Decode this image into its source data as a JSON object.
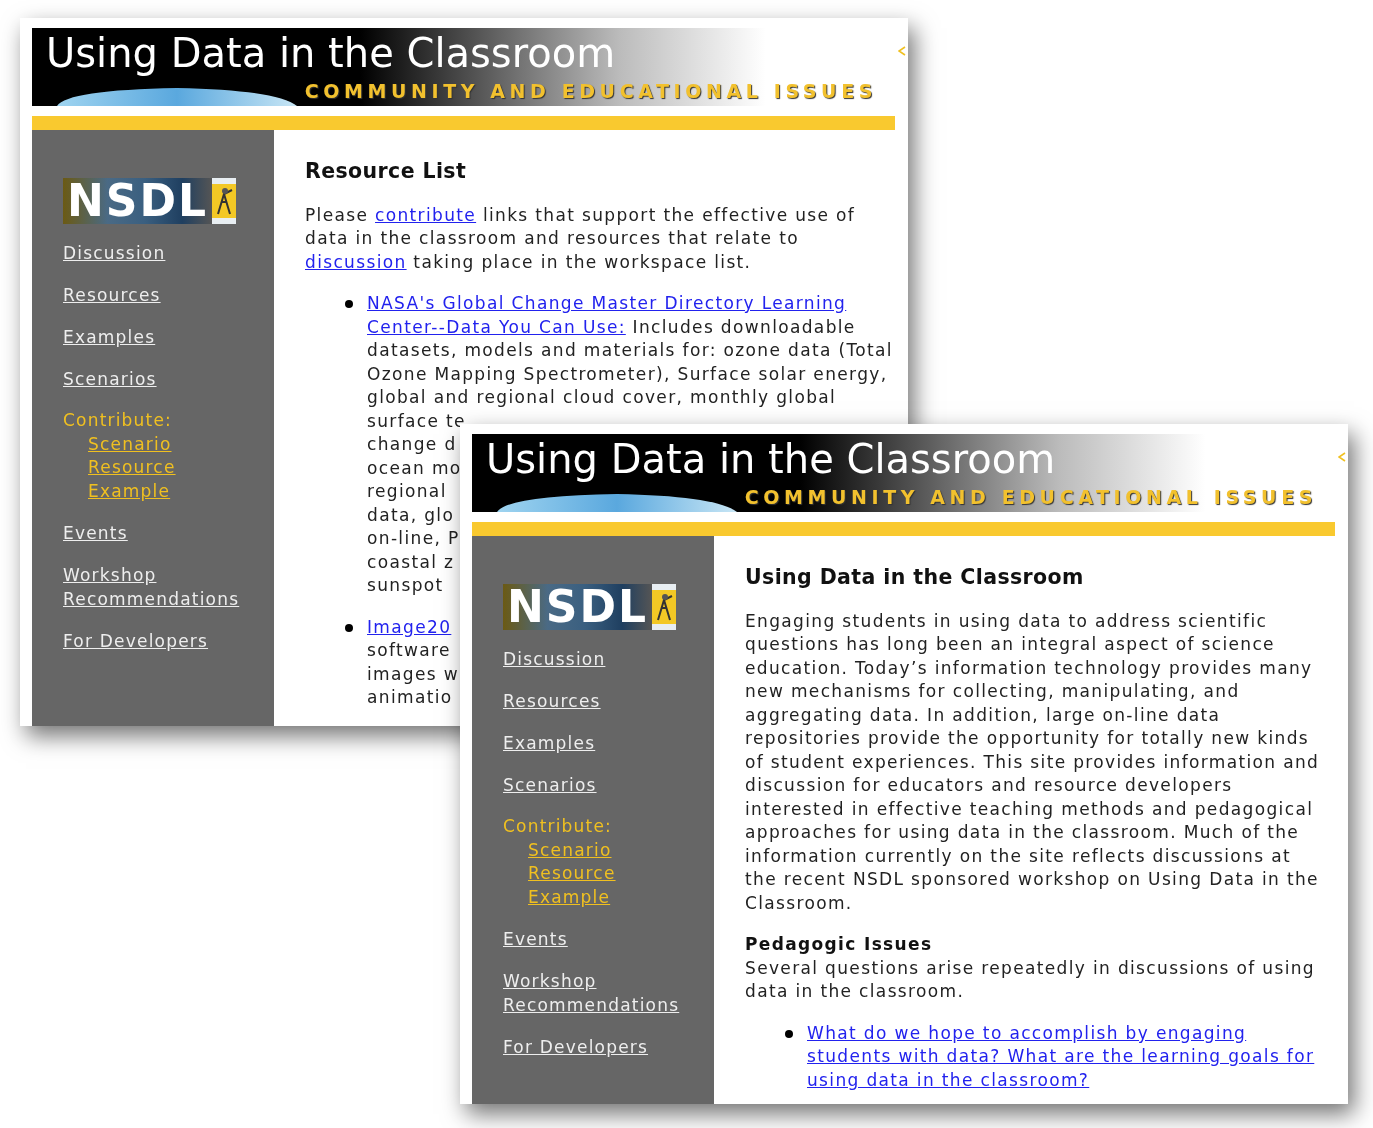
{
  "windows": [
    {
      "banner": {
        "title": "Using Data in the Classroom",
        "subtitle": "COMMUNITY AND EDUCATIONAL ISSUES"
      },
      "sidebar": {
        "logo": "NSDL",
        "items": [
          {
            "kind": "link",
            "label": "Discussion"
          },
          {
            "kind": "link",
            "label": "Resources"
          },
          {
            "kind": "link",
            "label": "Examples"
          },
          {
            "kind": "link",
            "label": "Scenarios"
          },
          {
            "kind": "group",
            "label": "Contribute:",
            "children": [
              "Scenario",
              "Resource",
              "Example"
            ]
          },
          {
            "kind": "link",
            "label": "Events"
          },
          {
            "kind": "link",
            "label": "Workshop Recommendations"
          },
          {
            "kind": "link",
            "label": "For Developers"
          }
        ]
      },
      "content": [
        {
          "kind": "heading",
          "text": "Resource List"
        },
        {
          "kind": "paragraph",
          "segments": [
            {
              "text": "Please "
            },
            {
              "link": "contribute"
            },
            {
              "text": " links that support the effective use of data in the classroom and resources that relate to "
            },
            {
              "link": "discussion"
            },
            {
              "text": " taking place in the workspace list."
            }
          ]
        },
        {
          "kind": "list",
          "items": [
            {
              "lines": [
                {
                  "link": "NASA's Global Change Master Directory Learning"
                },
                {
                  "link": "Center--Data You Can Use:",
                  "text": " Includes downloadable"
                },
                {
                  "text": "datasets, models and materials for: ozone data (Total"
                },
                {
                  "text": "Ozone Mapping Spectrometer), Surface solar energy,"
                },
                {
                  "text": "global and regional cloud cover, monthly global"
                },
                {
                  "text": "surface te"
                },
                {
                  "text": "change d"
                },
                {
                  "text": "ocean mo"
                },
                {
                  "text": "regional"
                },
                {
                  "text": "data, glo"
                },
                {
                  "text": "on-line, P"
                },
                {
                  "text": "coastal z"
                },
                {
                  "text": "sunspot"
                }
              ]
            },
            {
              "lines": [
                {
                  "link": "Image20"
                },
                {
                  "text": "software"
                },
                {
                  "text": "images w"
                },
                {
                  "text": "animatio"
                }
              ]
            }
          ]
        }
      ]
    },
    {
      "banner": {
        "title": "Using Data in the Classroom",
        "subtitle": "COMMUNITY AND EDUCATIONAL ISSUES"
      },
      "sidebar": {
        "logo": "NSDL",
        "items": [
          {
            "kind": "link",
            "label": "Discussion"
          },
          {
            "kind": "link",
            "label": "Resources"
          },
          {
            "kind": "link",
            "label": "Examples"
          },
          {
            "kind": "link",
            "label": "Scenarios"
          },
          {
            "kind": "group",
            "label": "Contribute:",
            "children": [
              "Scenario",
              "Resource",
              "Example"
            ]
          },
          {
            "kind": "link",
            "label": "Events"
          },
          {
            "kind": "link",
            "label": "Workshop Recommendations"
          },
          {
            "kind": "link",
            "label": "For Developers"
          }
        ]
      },
      "content": [
        {
          "kind": "heading",
          "text": "Using Data in the Classroom"
        },
        {
          "kind": "paragraph",
          "segments": [
            {
              "text": "Engaging students in using data to address scientific questions has long been an integral aspect of science education. Today’s information technology provides many new mechanisms for collecting, manipulating, and aggregating data. In addition, large on-line data repositories provide the opportunity for totally new kinds of student experiences. This site provides information and discussion for educators and resource developers interested in effective teaching methods and pedagogical approaches for using data in the classroom. Much of the information currently on the site reflects discussions at the recent NSDL sponsored workshop on Using Data in the Classroom."
            }
          ]
        },
        {
          "kind": "subheading",
          "text": "Pedagogic Issues"
        },
        {
          "kind": "paragraph",
          "segments": [
            {
              "text": "Several questions arise repeatedly in discussions of using data in the classroom."
            }
          ]
        },
        {
          "kind": "list",
          "items": [
            {
              "lines": [
                {
                  "link": "What do we hope to accomplish by engaging students with data? What are the learning goals for using data in the classroom?"
                }
              ]
            }
          ]
        }
      ]
    }
  ]
}
